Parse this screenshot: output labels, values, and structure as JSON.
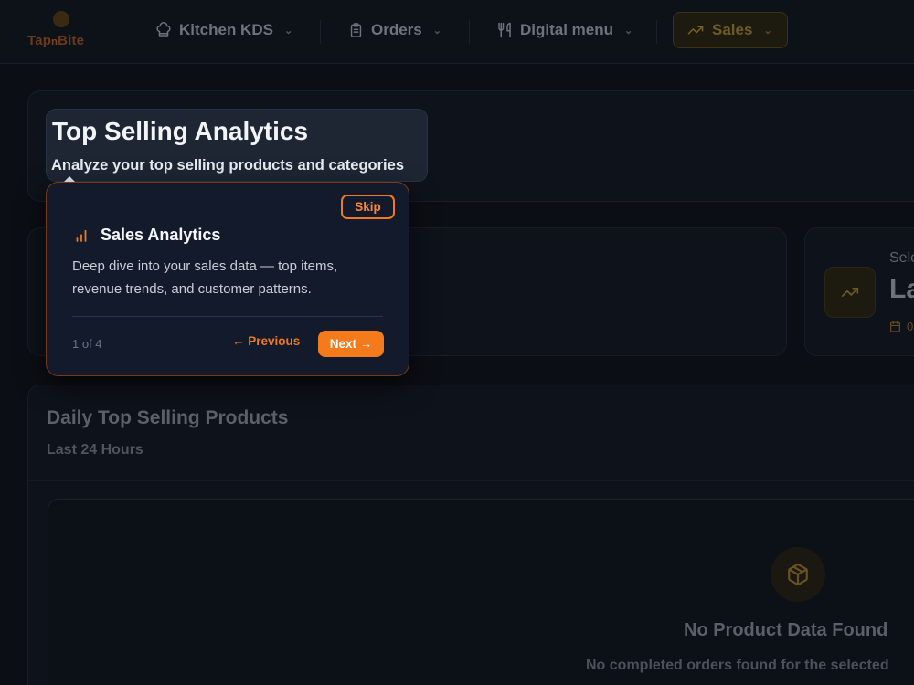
{
  "brand": {
    "name_left": "Tap",
    "name_mid": "n",
    "name_right": "Bite"
  },
  "nav": {
    "items": [
      {
        "label": "Kitchen KDS",
        "icon": "chef-hat-icon"
      },
      {
        "label": "Orders",
        "icon": "clipboard-icon"
      },
      {
        "label": "Digital menu",
        "icon": "utensils-icon"
      },
      {
        "label": "Sales",
        "icon": "trending-up-icon",
        "active": true
      }
    ]
  },
  "header": {
    "title": "Top Selling Analytics",
    "subtitle": "Analyze your top selling products and categories"
  },
  "stat_card": {
    "label": "Sele",
    "value": "La",
    "date_prefix": "0"
  },
  "daily_section": {
    "title": "Daily Top Selling Products",
    "subtitle": "Last 24 Hours",
    "empty_title": "No Product Data Found",
    "empty_desc": "No completed orders found for the selected"
  },
  "tour": {
    "skip_label": "Skip",
    "title": "Sales Analytics",
    "body": "Deep dive into your sales data — top items, revenue trends, and customer patterns.",
    "step": "1 of 4",
    "prev_label": "← Previous",
    "next_label": "Next →"
  },
  "colors": {
    "accent": "#f47a1c",
    "tour_bg": "#121a2c",
    "page_bg": "#0b0e14"
  }
}
